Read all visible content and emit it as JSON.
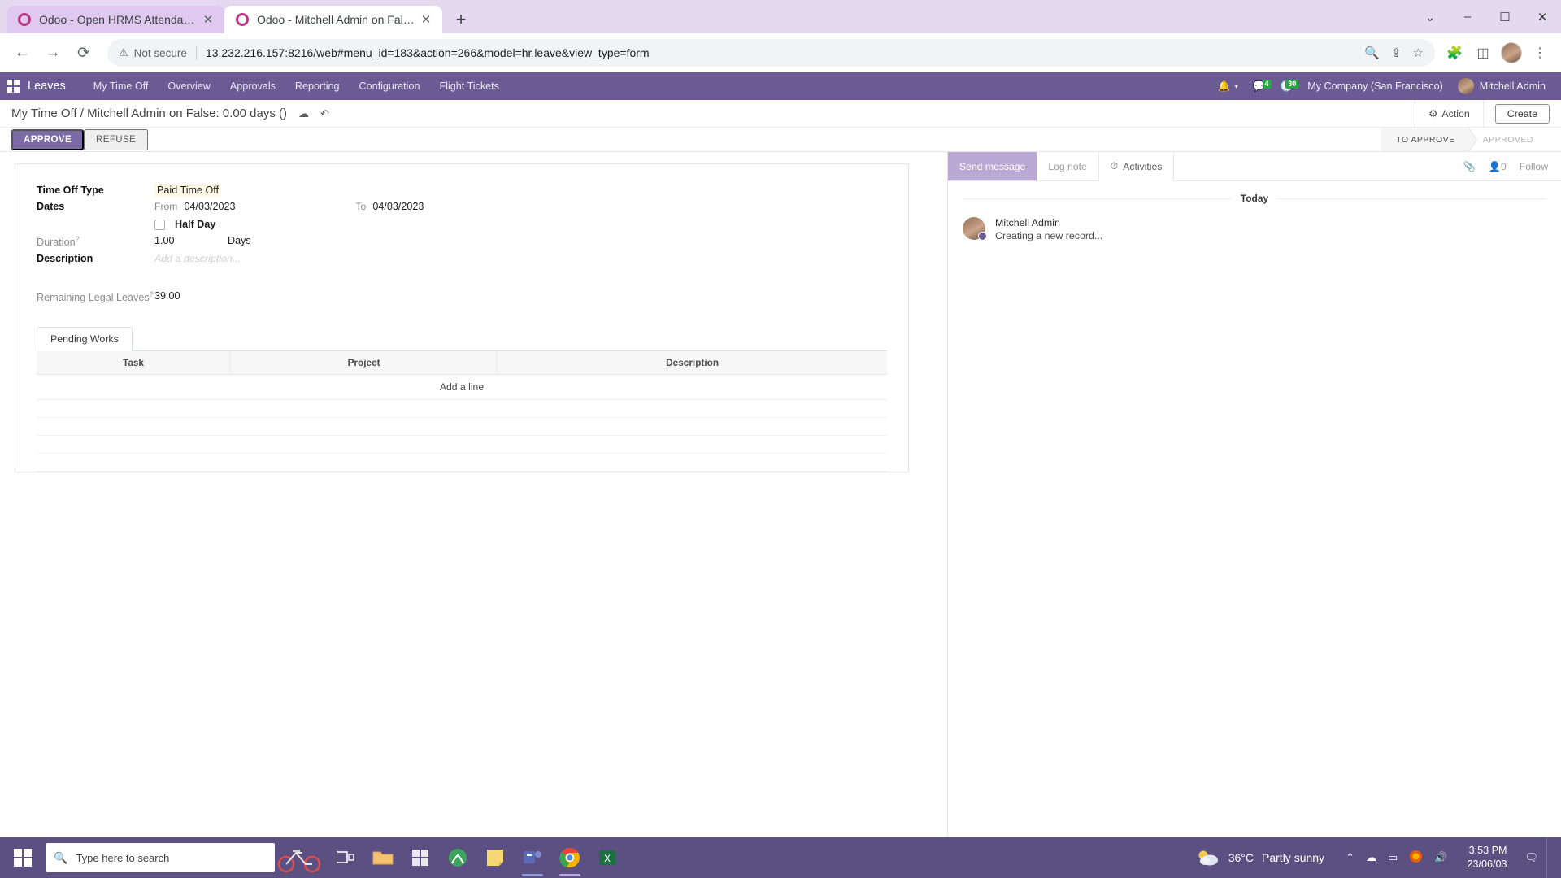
{
  "browser": {
    "tabs": [
      {
        "title": "Odoo - Open HRMS Attendance",
        "active": false,
        "favicon": "odoo-favicon"
      },
      {
        "title": "Odoo - Mitchell Admin on False:",
        "active": true,
        "favicon": "odoo-favicon"
      }
    ],
    "new_tab_label": "+",
    "window_controls": {
      "minimize": "–",
      "maximize": "☐",
      "close": "✕",
      "chevron": "⌄"
    },
    "nav": {
      "back": "←",
      "forward": "→",
      "reload": "⟳"
    },
    "omnibox": {
      "security_label": "Not secure",
      "warning_icon": "warning-triangle-icon",
      "url": "13.232.216.157:8216/web#menu_id=183&action=266&model=hr.leave&view_type=form",
      "zoom_icon": "search-icon",
      "share_icon": "share-icon",
      "bookmark_icon": "star-icon"
    },
    "toolbar_icons": [
      "extensions-icon",
      "sidepanel-icon",
      "profile-avatar",
      "menu-kebab-icon"
    ]
  },
  "odoo": {
    "navbar": {
      "apps_icon": "apps-grid-icon",
      "brand": "Leaves",
      "menu": [
        {
          "label": "My Time Off"
        },
        {
          "label": "Overview"
        },
        {
          "label": "Approvals"
        },
        {
          "label": "Reporting"
        },
        {
          "label": "Configuration"
        },
        {
          "label": "Flight Tickets"
        }
      ],
      "systray": {
        "bell_icon": "bell-icon",
        "bell_caret": "▾",
        "messages_icon": "chat-bubble-icon",
        "messages_count": "4",
        "activities_icon": "clock-icon",
        "activities_count": "30",
        "company": "My Company (San Francisco)",
        "user": "Mitchell Admin",
        "avatar": "user-avatar"
      }
    },
    "control_panel": {
      "breadcrumb": "My Time Off / Mitchell Admin on False: 0.00 days ()",
      "save_icon": "cloud-save-icon",
      "discard_icon": "undo-discard-icon",
      "action_label": "Action",
      "action_icon": "gear-icon",
      "create_label": "Create"
    },
    "statusbar": {
      "approve_label": "APPROVE",
      "refuse_label": "REFUSE",
      "stages": [
        {
          "label": "TO APPROVE",
          "active": true
        },
        {
          "label": "APPROVED",
          "active": false
        }
      ]
    },
    "form": {
      "time_off_type": {
        "label": "Time Off Type",
        "value": "Paid Time Off"
      },
      "dates": {
        "label": "Dates",
        "from_label": "From",
        "from_value": "04/03/2023",
        "to_label": "To",
        "to_value": "04/03/2023"
      },
      "half_day": {
        "label": "Half Day",
        "checked": false
      },
      "duration": {
        "label": "Duration",
        "value": "1.00",
        "unit": "Days",
        "tooltip_icon": "help-icon"
      },
      "description": {
        "label": "Description",
        "value": "",
        "placeholder": "Add a description..."
      },
      "remaining": {
        "label": "Remaining Legal Leaves",
        "value": "39.00",
        "tooltip_icon": "help-icon"
      }
    },
    "notebook": {
      "tabs": [
        {
          "label": "Pending Works",
          "active": true
        }
      ],
      "table": {
        "columns": [
          "Task",
          "Project",
          "Description"
        ],
        "rows": [],
        "add_line_label": "Add a line"
      }
    },
    "chatter": {
      "send_message_label": "Send message",
      "log_note_label": "Log note",
      "activities_label": "Activities",
      "activities_icon": "clock-icon",
      "attachment_icon": "paperclip-icon",
      "followers_icon": "user-follower-icon",
      "followers_count": "0",
      "follow_label": "Follow",
      "day_separator": "Today",
      "messages": [
        {
          "author": "Mitchell Admin",
          "body": "Creating a new record...",
          "avatar": "user-avatar"
        }
      ]
    }
  },
  "taskbar": {
    "start_icon": "windows-start-icon",
    "search_placeholder": "Type here to search",
    "search_icon": "magnifier-icon",
    "taskview_icon": "task-view-icon",
    "apps": [
      {
        "name": "file-explorer-icon",
        "color": "#f7c873"
      },
      {
        "name": "microsoft-store-icon",
        "color": "#f0f0f0"
      },
      {
        "name": "xbox-icon",
        "color": "#3ba55d"
      },
      {
        "name": "sticky-notes-icon",
        "color": "#f7d774"
      },
      {
        "name": "teams-icon",
        "color": "#5b6ab8"
      },
      {
        "name": "chrome-icon",
        "color": "#4285f4"
      },
      {
        "name": "excel-icon",
        "color": "#1d7044"
      }
    ],
    "weather": {
      "temperature": "36°C",
      "condition": "Partly sunny",
      "icon": "partly-sunny-icon"
    },
    "tray": {
      "chevron": "⌃",
      "onedrive_icon": "cloud-icon",
      "battery_icon": "battery-icon",
      "firefox_icon": "firefox-icon",
      "volume_icon": "speaker-icon"
    },
    "clock": {
      "time": "3:53 PM",
      "date": "23/06/03"
    },
    "notification_icon": "notification-icon"
  }
}
